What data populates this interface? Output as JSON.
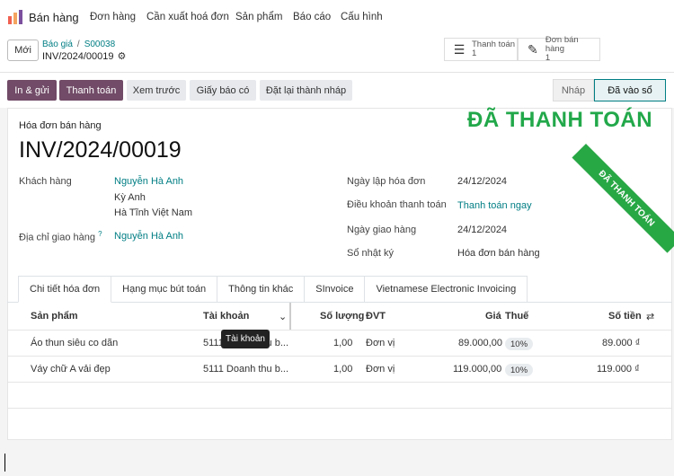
{
  "topnav": {
    "app_name": "Bán hàng",
    "items": [
      "Đơn hàng",
      "Cần xuất hoá đơn",
      "Sản phẩm",
      "Báo cáo",
      "Cấu hình"
    ]
  },
  "breadcrumb": {
    "new_button": "Mới",
    "parent": "Báo giá",
    "separator": "/",
    "parent_ref": "S00038",
    "current": "INV/2024/00019"
  },
  "smart_buttons": [
    {
      "label": "Thanh toán",
      "count": "1",
      "icon": "list-icon"
    },
    {
      "label": "Đơn bán hàng",
      "count": "1",
      "icon": "edit-icon"
    }
  ],
  "actions": {
    "send_print": "In & gửi",
    "pay": "Thanh toán",
    "preview": "Xem trước",
    "credit_note": "Giấy báo có",
    "reset_draft": "Đặt lại thành nháp"
  },
  "status": {
    "draft": "Nháp",
    "posted": "Đã vào sổ"
  },
  "stamp": {
    "paid_text": "ĐÃ THANH TOÁN",
    "ribbon_text": "ĐÃ THANH TOÁN",
    "color": "#22a84a"
  },
  "invoice": {
    "type": "Hóa đơn bán hàng",
    "number": "INV/2024/00019",
    "customer_label": "Khách hàng",
    "customer_name": "Nguyễn Hà Anh",
    "customer_address_1": "Kỳ Anh",
    "customer_address_2": "Hà Tĩnh Việt Nam",
    "delivery_label": "Địa chỉ giao hàng",
    "delivery_help": "?",
    "delivery_name": "Nguyễn Hà Anh",
    "invoice_date_label": "Ngày lập hóa đơn",
    "invoice_date": "24/12/2024",
    "payment_terms_label": "Điều khoản thanh toán",
    "payment_terms": "Thanh toán ngay",
    "delivery_date_label": "Ngày giao hàng",
    "delivery_date": "24/12/2024",
    "journal_label": "Sổ nhật ký",
    "journal": "Hóa đơn bán hàng"
  },
  "tabs": [
    "Chi tiết hóa đơn",
    "Hạng mục bút toán",
    "Thông tin khác",
    "SInvoice",
    "Vietnamese Electronic Invoicing"
  ],
  "table": {
    "headers": {
      "product": "Sản phẩm",
      "account": "Tài khoản",
      "quantity": "Số lượng",
      "uom": "ĐVT",
      "price": "Giá",
      "tax": "Thuế",
      "amount": "Số tiền"
    },
    "rows": [
      {
        "product": "Áo thun siêu co dãn",
        "account": "5111 Doanh thu b...",
        "quantity": "1,00",
        "uom": "Đơn vị",
        "price": "89.000,00",
        "tax": "10%",
        "amount": "89.000 ₫"
      },
      {
        "product": "Váy chữ A vải đẹp",
        "account": "5111 Doanh thu b...",
        "quantity": "1,00",
        "uom": "Đơn vị",
        "price": "119.000,00",
        "tax": "10%",
        "amount": "119.000 ₫"
      }
    ],
    "tooltip": "Tài khoản"
  }
}
